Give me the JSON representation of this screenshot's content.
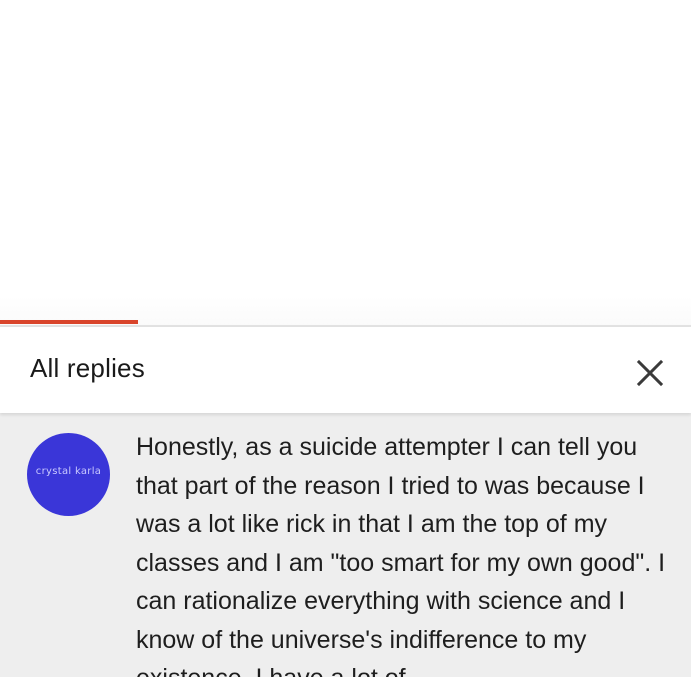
{
  "replies_panel": {
    "title": "All replies",
    "close_icon": "close-icon"
  },
  "comment": {
    "avatar_label": "crystal karla",
    "avatar_color": "#3a36d8",
    "text": "Honestly, as a suicide attempter I can tell you that part of the reason I tried to was because I was a lot like rick in that I am the top of my classes and I am \"too smart for my own good\". I can rationalize everything with science and I know of the universe's indifference to my existence. I have a lot of"
  },
  "colors": {
    "tab_indicator": "#d9452b",
    "comment_background": "#eeeeee"
  }
}
